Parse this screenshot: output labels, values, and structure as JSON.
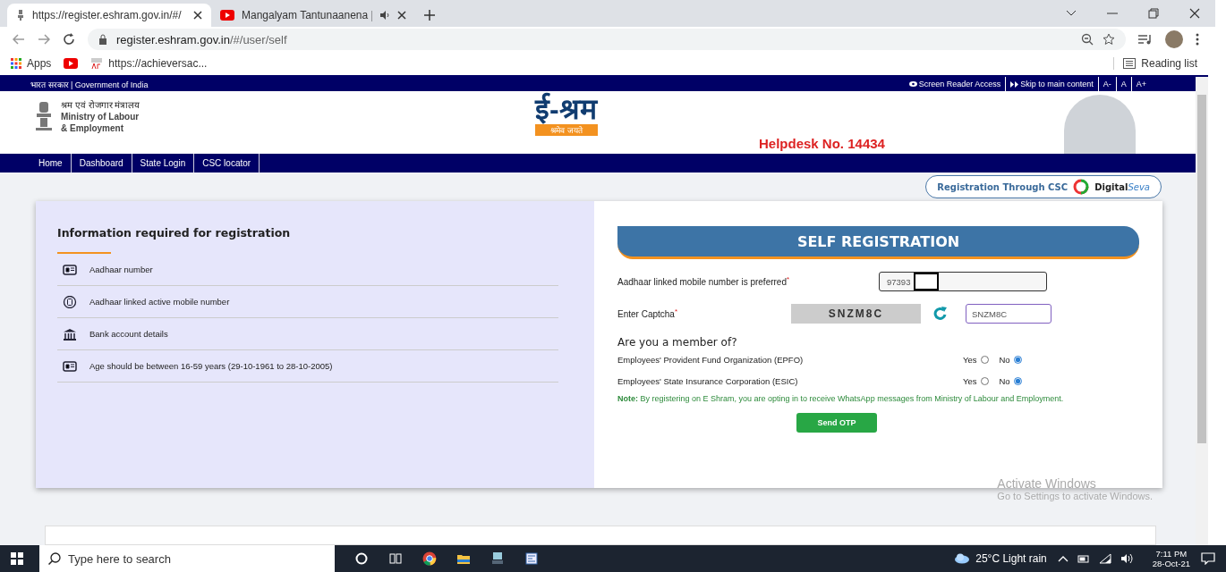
{
  "browser": {
    "tabs": [
      {
        "title": "https://register.eshram.gov.in/#/",
        "kind": "site",
        "selected": true,
        "audio": false
      },
      {
        "title": "Mangalyam Tantunaanena | ",
        "kind": "video",
        "selected": false,
        "audio": true
      }
    ],
    "address": {
      "host": "register.eshram.gov.in",
      "path": "/#/user/self"
    },
    "bookmarks": [
      {
        "label": "Apps",
        "kind": "apps"
      },
      {
        "kind": "video"
      },
      {
        "label": "https://achieversac...",
        "kind": "site"
      }
    ],
    "reading_list": "Reading list"
  },
  "gov_bar": {
    "title": "भारत सरकार | Government of India",
    "links": [
      "Screen Reader Access",
      "Skip to main content"
    ],
    "font_sizes": [
      "A-",
      "A",
      "A+"
    ]
  },
  "header": {
    "ministry": [
      "श्रम एवं रोजगार मंत्रालय",
      "Ministry of Labour",
      "& Employment"
    ],
    "logo": {
      "title": "ई-श्रम",
      "motto": "श्रमेव जयते"
    },
    "helpdesk": "Helpdesk No. 14434"
  },
  "nav": [
    {
      "label": "Home"
    },
    {
      "label": "Dashboard"
    },
    {
      "label": "State Login"
    },
    {
      "label": "CSC locator"
    }
  ],
  "csc_button": {
    "label": "Registration Through CSC",
    "brand": "Digital",
    "brand_suffix": "Seva"
  },
  "info": {
    "title": "Information required for registration",
    "items": [
      {
        "label": "Aadhaar number",
        "kind": "card"
      },
      {
        "label": "Aadhaar linked active mobile number",
        "kind": "phone"
      },
      {
        "label": "Bank account details",
        "kind": "bank"
      },
      {
        "label": "Age should be between 16-59 years (29-10-1961 to 28-10-2005)",
        "kind": "card"
      }
    ]
  },
  "form": {
    "title": "SELF REGISTRATION",
    "mobile": {
      "label": "Aadhaar linked mobile number is preferred",
      "required_mark": "*",
      "value": "97393"
    },
    "captcha": {
      "label": "Enter Captcha",
      "required_mark": "*",
      "image_text": "SNZM8C",
      "value": "SNZM8C"
    },
    "member_question": "Are you a member of?",
    "memberships": [
      {
        "label": "Employees' Provident Fund Organization (EPFO)",
        "options": [
          {
            "label": "Yes",
            "selected": false
          },
          {
            "label": "No",
            "selected": true
          }
        ]
      },
      {
        "label": "Employees' State Insurance Corporation (ESIC)",
        "options": [
          {
            "label": "Yes",
            "selected": false
          },
          {
            "label": "No",
            "selected": true
          }
        ]
      }
    ],
    "note": "**Note:** By registering on E Shram, you are opting in to receive WhatsApp messages from Ministry of Labour and Employment.",
    "submit": "Send OTP"
  },
  "activation": {
    "title": "Activate Windows",
    "hint": "Go to Settings to activate Windows."
  },
  "taskbar": {
    "search_placeholder": "Type here to search",
    "weather": "25°C  Light rain",
    "time": "7:11 PM",
    "date": "28-Oct-21"
  }
}
